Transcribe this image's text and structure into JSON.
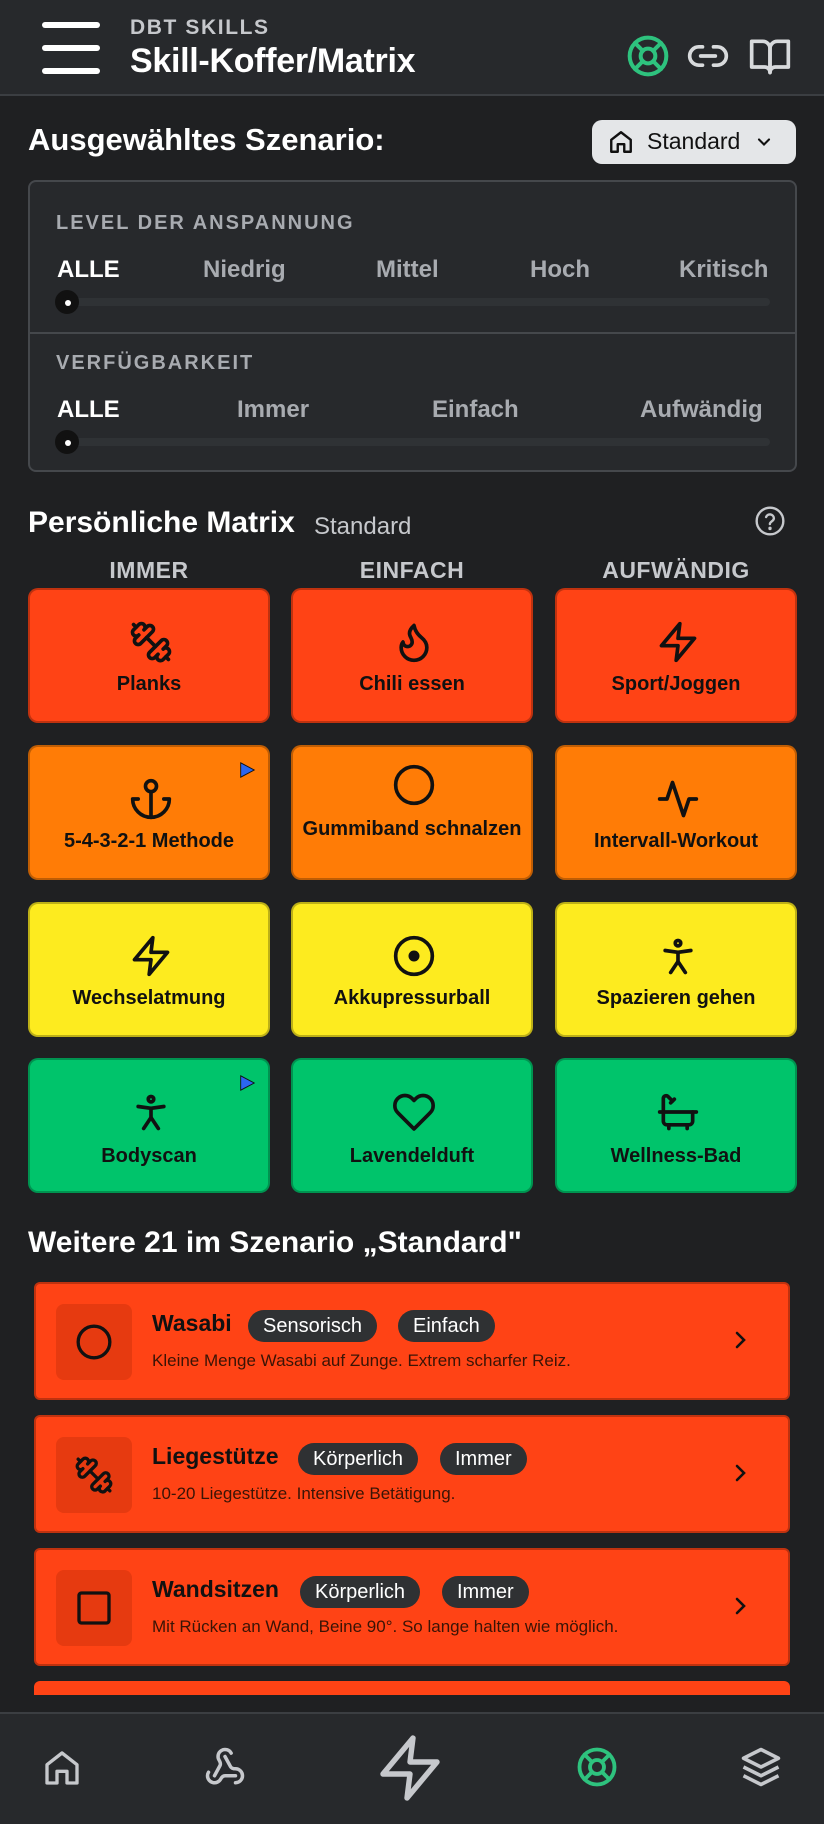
{
  "header": {
    "kicker": "DBT SKILLS",
    "title": "Skill-Koffer/Matrix",
    "icons": [
      "lifebuoy-icon",
      "link-icon",
      "book-icon"
    ],
    "accent_color": "#2ec27e"
  },
  "scenario": {
    "label": "Ausgewähltes Szenario:",
    "selected": "Standard"
  },
  "filters": {
    "tension": {
      "title": "LEVEL DER ANSPANNUNG",
      "options": [
        "ALLE",
        "Niedrig",
        "Mittel",
        "Hoch",
        "Kritisch"
      ],
      "selected": "ALLE"
    },
    "availability": {
      "title": "VERFÜGBARKEIT",
      "options": [
        "ALLE",
        "Immer",
        "Einfach",
        "Aufwändig"
      ],
      "selected": "ALLE"
    }
  },
  "matrix": {
    "title": "Persönliche Matrix",
    "subtitle": "Standard",
    "columns": [
      "IMMER",
      "EINFACH",
      "AUFWÄNDIG"
    ],
    "rows": [
      {
        "color": "#ff4315",
        "tiles": [
          {
            "label": "Planks",
            "icon": "dumbbell-icon",
            "play": false
          },
          {
            "label": "Chili essen",
            "icon": "flame-icon",
            "play": false
          },
          {
            "label": "Sport/Joggen",
            "icon": "zap-icon",
            "play": false
          }
        ]
      },
      {
        "color": "#ff7c06",
        "tiles": [
          {
            "label": "5-4-3-2-1 Methode",
            "icon": "anchor-icon",
            "play": true
          },
          {
            "label": "Gummiband schnalzen",
            "icon": "circle-icon",
            "play": false
          },
          {
            "label": "Intervall-Workout",
            "icon": "activity-icon",
            "play": false
          }
        ]
      },
      {
        "color": "#fdeb1f",
        "tiles": [
          {
            "label": "Wechselatmung",
            "icon": "zap-icon",
            "play": false
          },
          {
            "label": "Akkupressurball",
            "icon": "target-icon",
            "play": false
          },
          {
            "label": "Spazieren gehen",
            "icon": "person-icon",
            "play": false
          }
        ]
      },
      {
        "color": "#00c46b",
        "tiles": [
          {
            "label": "Bodyscan",
            "icon": "person-icon",
            "play": true
          },
          {
            "label": "Lavendelduft",
            "icon": "heart-icon",
            "play": false
          },
          {
            "label": "Wellness-Bad",
            "icon": "bath-icon",
            "play": false
          }
        ]
      }
    ]
  },
  "more": {
    "title": "Weitere 21 im Szenario „Standard\"",
    "items": [
      {
        "name": "Wasabi",
        "tags": [
          "Sensorisch",
          "Einfach"
        ],
        "desc": "Kleine Menge Wasabi auf Zunge. Extrem scharfer Reiz.",
        "icon": "circle-icon"
      },
      {
        "name": "Liegestütze",
        "tags": [
          "Körperlich",
          "Immer"
        ],
        "desc": "10-20 Liegestütze. Intensive Betätigung.",
        "icon": "dumbbell-icon"
      },
      {
        "name": "Wandsitzen",
        "tags": [
          "Körperlich",
          "Immer"
        ],
        "desc": "Mit Rücken an Wand, Beine 90°. So lange halten wie möglich.",
        "icon": "square-icon"
      }
    ]
  },
  "bottom_nav": [
    "home-icon",
    "webhook-icon",
    "zap-icon",
    "lifebuoy-icon",
    "layers-icon"
  ]
}
